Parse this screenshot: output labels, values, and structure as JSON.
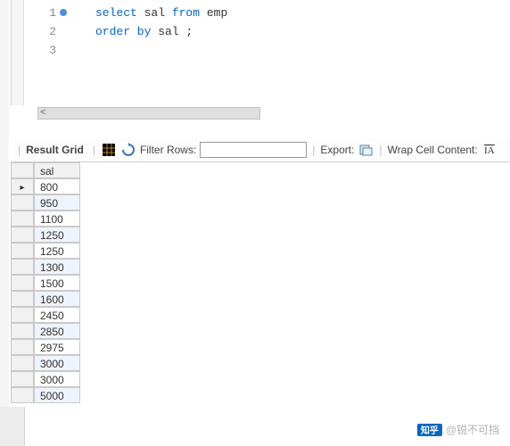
{
  "editor": {
    "lines": [
      {
        "num": "1",
        "marker": true,
        "tokens": [
          {
            "t": "select",
            "c": "kw"
          },
          {
            "t": " sal ",
            "c": "ident"
          },
          {
            "t": "from",
            "c": "kw"
          },
          {
            "t": " emp",
            "c": "ident"
          }
        ]
      },
      {
        "num": "2",
        "marker": false,
        "tokens": [
          {
            "t": "order by",
            "c": "kw"
          },
          {
            "t": " sal ;",
            "c": "ident"
          }
        ]
      },
      {
        "num": "3",
        "marker": false,
        "tokens": []
      }
    ]
  },
  "toolbar": {
    "result_grid_label": "Result Grid",
    "filter_label": "Filter Rows:",
    "filter_value": "",
    "export_label": "Export:",
    "wrap_label": "Wrap Cell Content:"
  },
  "grid": {
    "columns": [
      "sal"
    ],
    "rows": [
      "800",
      "950",
      "1100",
      "1250",
      "1250",
      "1300",
      "1500",
      "1600",
      "2450",
      "2850",
      "2975",
      "3000",
      "3000",
      "5000"
    ],
    "cursor_index": 0
  },
  "watermark": {
    "logo_text": "知乎",
    "author": "@锐不可挡"
  }
}
